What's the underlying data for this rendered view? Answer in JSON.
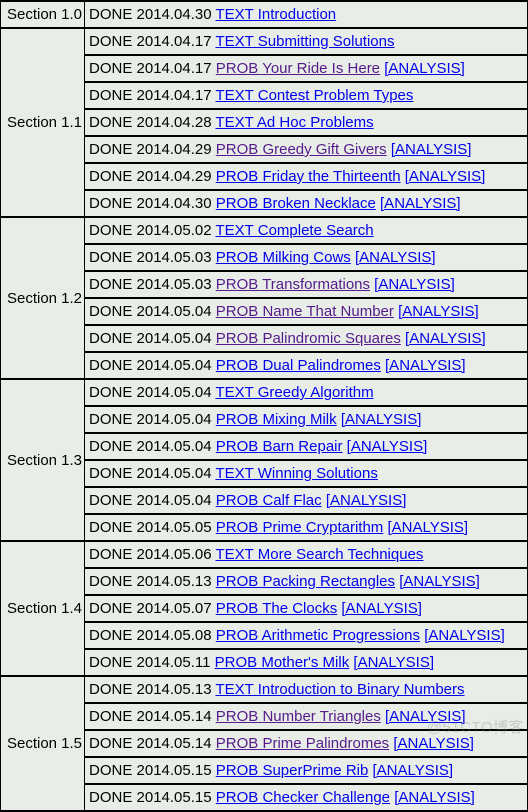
{
  "watermark": "@51CTO博客",
  "labels": {
    "status_done": "DONE",
    "kind_text": "TEXT",
    "kind_prob": "PROB",
    "analysis": "[ANALYSIS]"
  },
  "colors": {
    "page_background": "#e8eee7",
    "border": "#000000",
    "link_new": "#0000ee",
    "link_visited": "#551a8b",
    "text": "#000000"
  },
  "sections": [
    {
      "name": "Section 1.0",
      "rows": [
        {
          "status": "DONE",
          "date": "2014.04.30",
          "kind": "TEXT",
          "title": "Introduction",
          "link_state": "new",
          "analysis": null,
          "analysis_state": null
        }
      ]
    },
    {
      "name": "Section 1.1",
      "rows": [
        {
          "status": "DONE",
          "date": "2014.04.17",
          "kind": "TEXT",
          "title": "Submitting Solutions",
          "link_state": "new",
          "analysis": null,
          "analysis_state": null
        },
        {
          "status": "DONE",
          "date": "2014.04.17",
          "kind": "PROB",
          "title": "Your Ride Is Here",
          "link_state": "visited",
          "analysis": "[ANALYSIS]",
          "analysis_state": "new"
        },
        {
          "status": "DONE",
          "date": "2014.04.17",
          "kind": "TEXT",
          "title": "Contest Problem Types",
          "link_state": "new",
          "analysis": null,
          "analysis_state": null
        },
        {
          "status": "DONE",
          "date": "2014.04.28",
          "kind": "TEXT",
          "title": "Ad Hoc Problems",
          "link_state": "new",
          "analysis": null,
          "analysis_state": null
        },
        {
          "status": "DONE",
          "date": "2014.04.29",
          "kind": "PROB",
          "title": "Greedy Gift Givers",
          "link_state": "visited",
          "analysis": "[ANALYSIS]",
          "analysis_state": "new"
        },
        {
          "status": "DONE",
          "date": "2014.04.29",
          "kind": "PROB",
          "title": "Friday the Thirteenth",
          "link_state": "new",
          "analysis": "[ANALYSIS]",
          "analysis_state": "new"
        },
        {
          "status": "DONE",
          "date": "2014.04.30",
          "kind": "PROB",
          "title": "Broken Necklace",
          "link_state": "new",
          "analysis": "[ANALYSIS]",
          "analysis_state": "new"
        }
      ]
    },
    {
      "name": "Section 1.2",
      "rows": [
        {
          "status": "DONE",
          "date": "2014.05.02",
          "kind": "TEXT",
          "title": "Complete Search",
          "link_state": "new",
          "analysis": null,
          "analysis_state": null
        },
        {
          "status": "DONE",
          "date": "2014.05.03",
          "kind": "PROB",
          "title": "Milking Cows",
          "link_state": "new",
          "analysis": "[ANALYSIS]",
          "analysis_state": "new"
        },
        {
          "status": "DONE",
          "date": "2014.05.03",
          "kind": "PROB",
          "title": "Transformations",
          "link_state": "visited",
          "analysis": "[ANALYSIS]",
          "analysis_state": "new"
        },
        {
          "status": "DONE",
          "date": "2014.05.04",
          "kind": "PROB",
          "title": "Name That Number",
          "link_state": "visited",
          "analysis": "[ANALYSIS]",
          "analysis_state": "new"
        },
        {
          "status": "DONE",
          "date": "2014.05.04",
          "kind": "PROB",
          "title": "Palindromic Squares",
          "link_state": "visited",
          "analysis": "[ANALYSIS]",
          "analysis_state": "new"
        },
        {
          "status": "DONE",
          "date": "2014.05.04",
          "kind": "PROB",
          "title": "Dual Palindromes",
          "link_state": "new",
          "analysis": "[ANALYSIS]",
          "analysis_state": "new"
        }
      ]
    },
    {
      "name": "Section 1.3",
      "rows": [
        {
          "status": "DONE",
          "date": "2014.05.04",
          "kind": "TEXT",
          "title": "Greedy Algorithm",
          "link_state": "new",
          "analysis": null,
          "analysis_state": null
        },
        {
          "status": "DONE",
          "date": "2014.05.04",
          "kind": "PROB",
          "title": "Mixing Milk",
          "link_state": "new",
          "analysis": "[ANALYSIS]",
          "analysis_state": "new"
        },
        {
          "status": "DONE",
          "date": "2014.05.04",
          "kind": "PROB",
          "title": "Barn Repair",
          "link_state": "new",
          "analysis": "[ANALYSIS]",
          "analysis_state": "new"
        },
        {
          "status": "DONE",
          "date": "2014.05.04",
          "kind": "TEXT",
          "title": "Winning Solutions",
          "link_state": "new",
          "analysis": null,
          "analysis_state": null
        },
        {
          "status": "DONE",
          "date": "2014.05.04",
          "kind": "PROB",
          "title": "Calf Flac",
          "link_state": "new",
          "analysis": "[ANALYSIS]",
          "analysis_state": "new"
        },
        {
          "status": "DONE",
          "date": "2014.05.05",
          "kind": "PROB",
          "title": "Prime Cryptarithm",
          "link_state": "new",
          "analysis": "[ANALYSIS]",
          "analysis_state": "new"
        }
      ]
    },
    {
      "name": "Section 1.4",
      "rows": [
        {
          "status": "DONE",
          "date": "2014.05.06",
          "kind": "TEXT",
          "title": "More Search Techniques",
          "link_state": "new",
          "analysis": null,
          "analysis_state": null
        },
        {
          "status": "DONE",
          "date": "2014.05.13",
          "kind": "PROB",
          "title": "Packing Rectangles",
          "link_state": "new",
          "analysis": "[ANALYSIS]",
          "analysis_state": "new"
        },
        {
          "status": "DONE",
          "date": "2014.05.07",
          "kind": "PROB",
          "title": "The Clocks",
          "link_state": "new",
          "analysis": "[ANALYSIS]",
          "analysis_state": "new"
        },
        {
          "status": "DONE",
          "date": "2014.05.08",
          "kind": "PROB",
          "title": "Arithmetic Progressions",
          "link_state": "new",
          "analysis": "[ANALYSIS]",
          "analysis_state": "new"
        },
        {
          "status": "DONE",
          "date": "2014.05.11",
          "kind": "PROB",
          "title": "Mother's Milk",
          "link_state": "new",
          "analysis": "[ANALYSIS]",
          "analysis_state": "new"
        }
      ]
    },
    {
      "name": "Section 1.5",
      "rows": [
        {
          "status": "DONE",
          "date": "2014.05.13",
          "kind": "TEXT",
          "title": "Introduction to Binary Numbers",
          "link_state": "new",
          "analysis": null,
          "analysis_state": null
        },
        {
          "status": "DONE",
          "date": "2014.05.14",
          "kind": "PROB",
          "title": "Number Triangles",
          "link_state": "visited",
          "analysis": "[ANALYSIS]",
          "analysis_state": "new"
        },
        {
          "status": "DONE",
          "date": "2014.05.14",
          "kind": "PROB",
          "title": "Prime Palindromes",
          "link_state": "visited",
          "analysis": "[ANALYSIS]",
          "analysis_state": "new"
        },
        {
          "status": "DONE",
          "date": "2014.05.15",
          "kind": "PROB",
          "title": "SuperPrime Rib",
          "link_state": "new",
          "analysis": "[ANALYSIS]",
          "analysis_state": "new"
        },
        {
          "status": "DONE",
          "date": "2014.05.15",
          "kind": "PROB",
          "title": "Checker Challenge",
          "link_state": "new",
          "analysis": "[ANALYSIS]",
          "analysis_state": "new"
        }
      ]
    }
  ]
}
